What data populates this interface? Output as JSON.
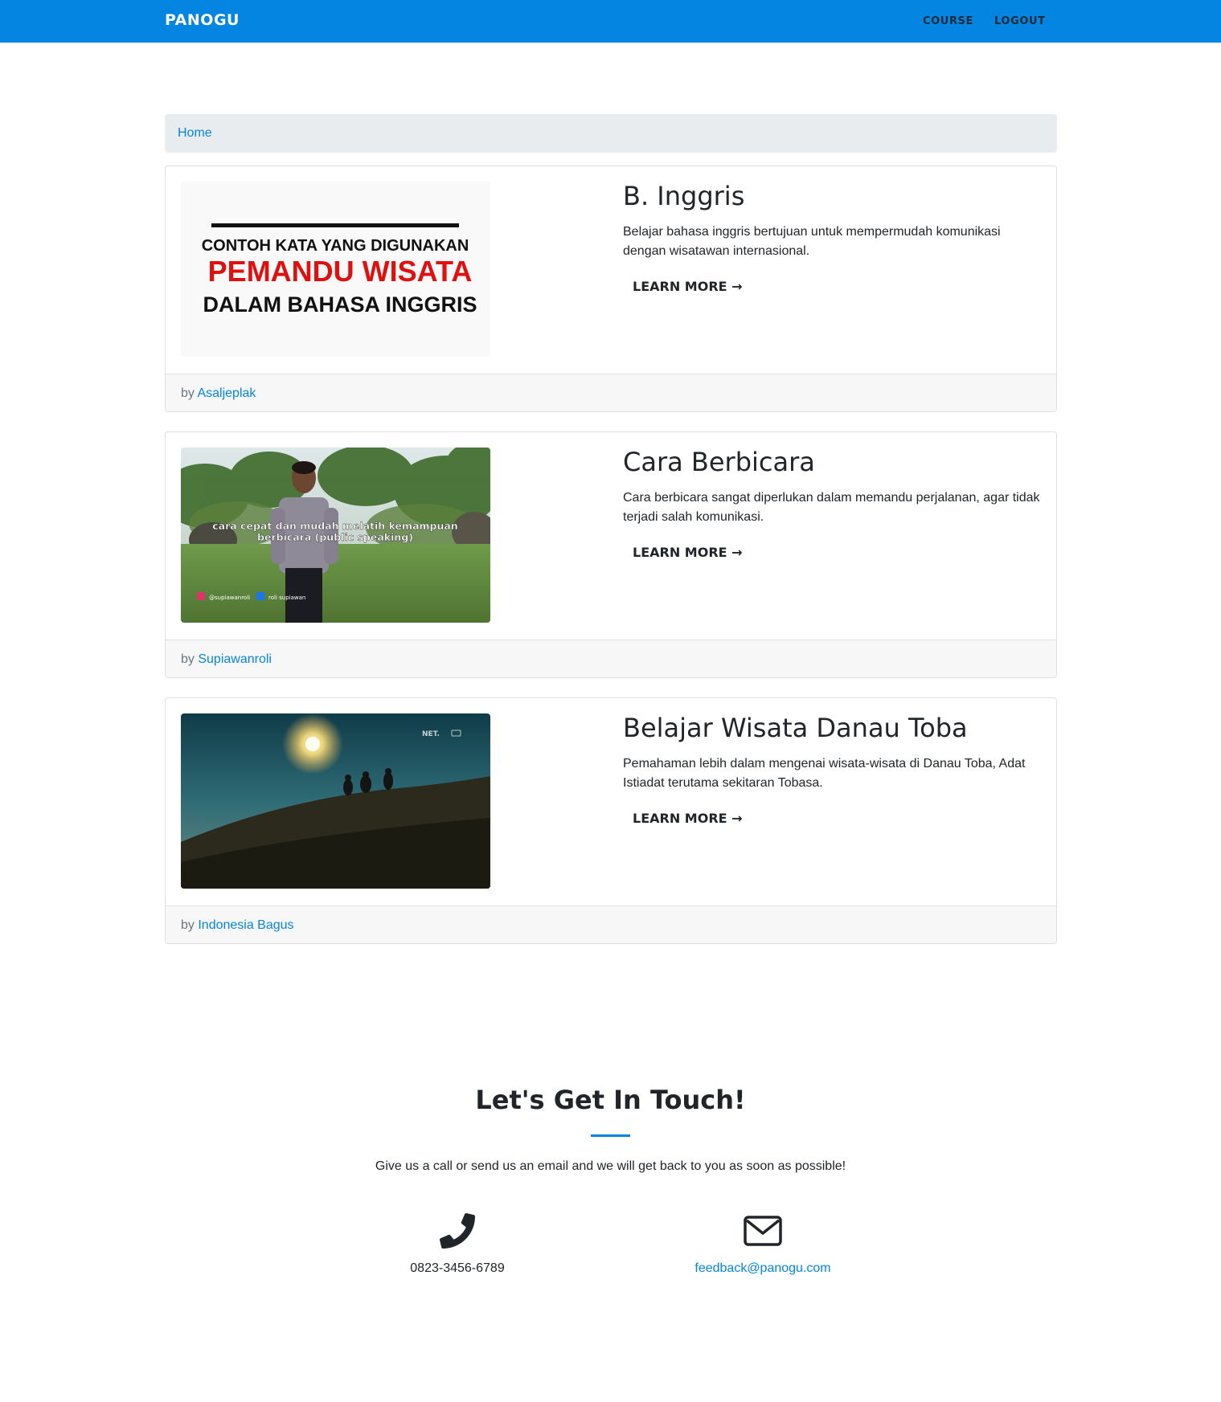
{
  "nav": {
    "brand": "PANOGU",
    "links": [
      {
        "label": "COURSE"
      },
      {
        "label": "LOGOUT"
      }
    ]
  },
  "breadcrumb": {
    "home": "Home"
  },
  "courses": [
    {
      "title": "B. Inggris",
      "description": "Belajar bahasa inggris bertujuan untuk mempermudah komunikasi dengan wisatawan internasional.",
      "cta": "LEARN MORE →",
      "by": "by",
      "author": "Asaljeplak",
      "thumbnail": {
        "line1": "CONTOH KATA YANG DIGUNAKAN",
        "line2": "PEMANDU WISATA",
        "line3": "DALAM BAHASA INGGRIS"
      }
    },
    {
      "title": "Cara Berbicara",
      "description": "Cara berbicara sangat diperlukan dalam memandu perjalanan, agar tidak terjadi salah komunikasi.",
      "cta": "LEARN MORE →",
      "by": "by",
      "author": "Supiawanroli",
      "thumbnail": {
        "caption1": "cara cepat dan mudah melatih kemampuan",
        "caption2": "berbicara (public speaking)",
        "ig": "@supiawanroli",
        "fb": "roli supiawan"
      }
    },
    {
      "title": "Belajar Wisata Danau Toba",
      "description": "Pemahaman lebih dalam mengenai wisata-wisata di Danau Toba, Adat Istiadat terutama sekitaran Tobasa.",
      "cta": "LEARN MORE →",
      "by": "by",
      "author": "Indonesia Bagus",
      "thumbnail": {
        "channel": "NET."
      }
    }
  ],
  "contact": {
    "title": "Let's Get In Touch!",
    "lead": "Give us a call or send us an email and we will get back to you as soon as possible!",
    "phone": "0823-3456-6789",
    "email": "feedback@panogu.com",
    "phone_icon": "phone-icon",
    "email_icon": "envelope-icon"
  },
  "colors": {
    "primary": "#0585e2",
    "nav_link": "#1c2b38",
    "breadcrumb_bg": "#e9ecef",
    "footer_bg": "#f7f7f7",
    "thumb_red": "#e01010"
  }
}
